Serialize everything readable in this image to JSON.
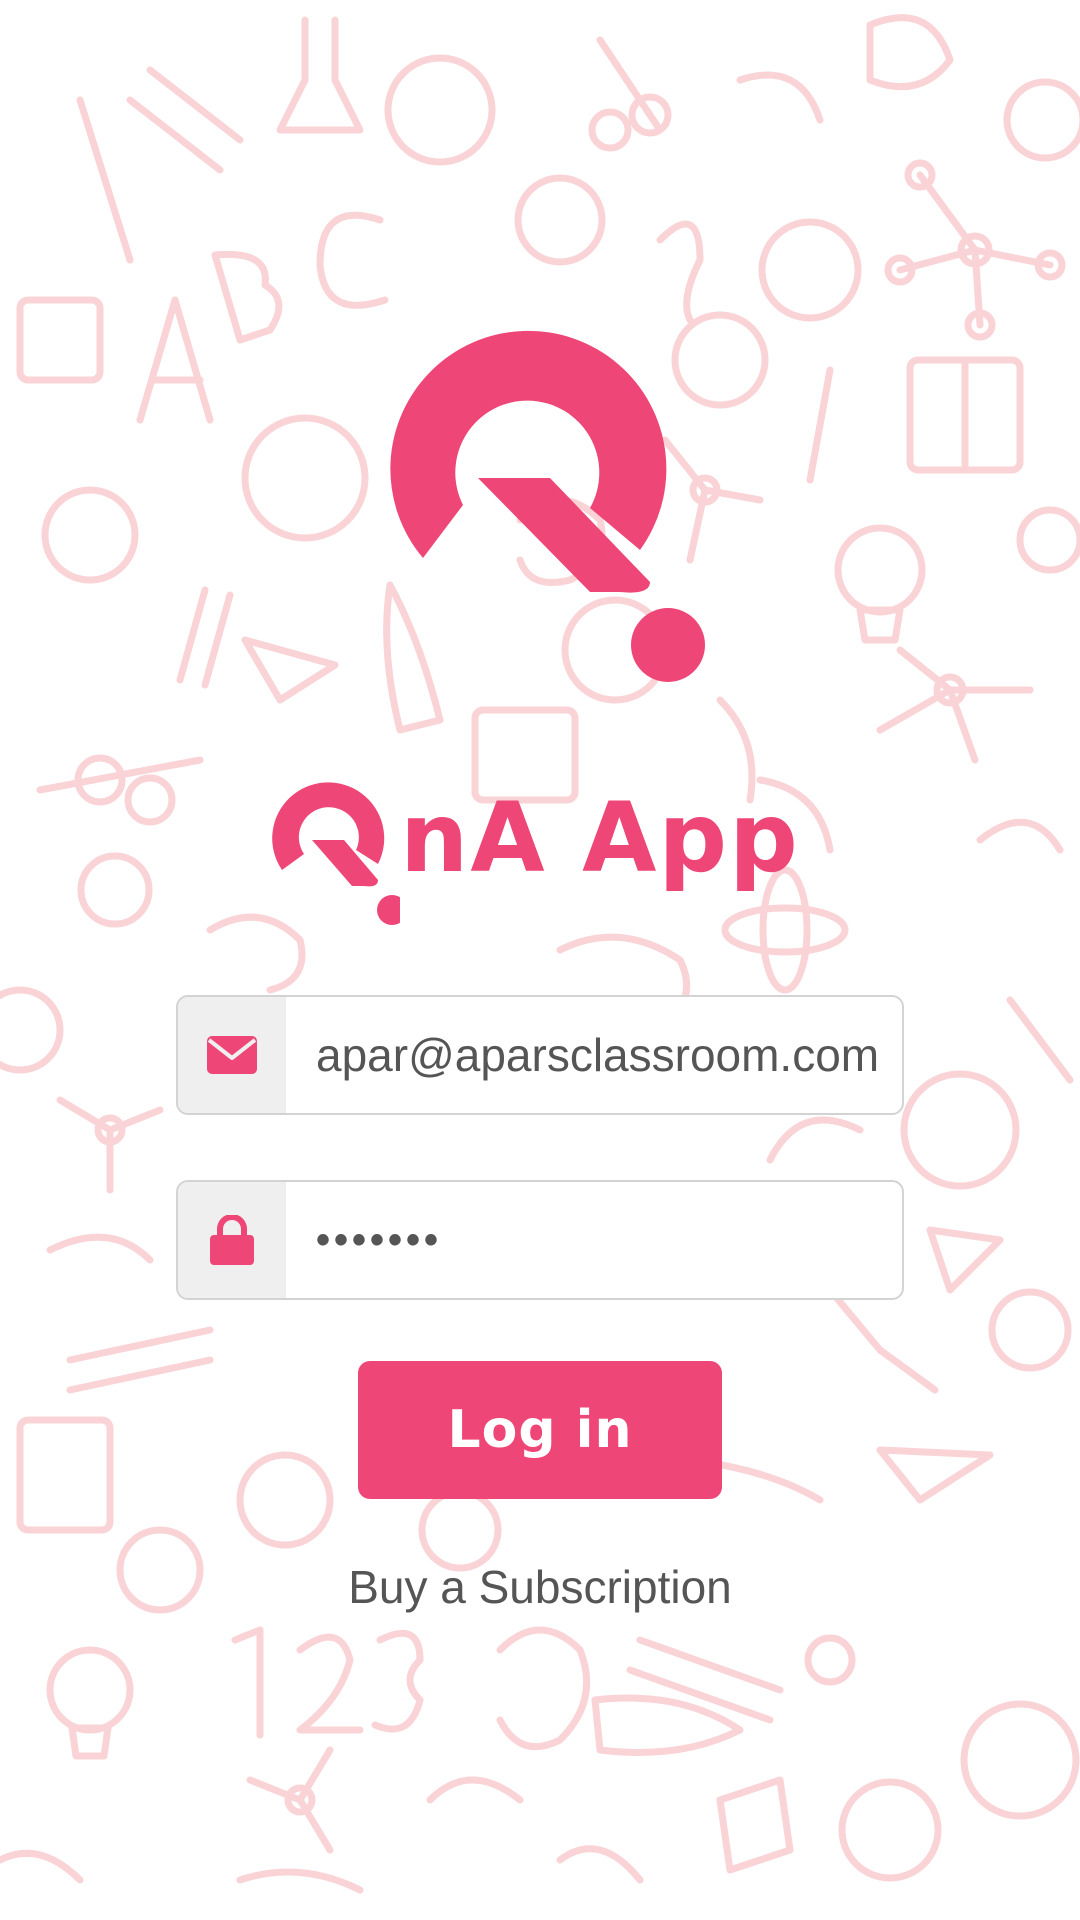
{
  "app": {
    "name": "QnA App",
    "brand_color": "#ee4677",
    "pattern_color": "#f9d3d6"
  },
  "logo": {
    "icon": "q-logo-icon",
    "wordmark_text": "nA App"
  },
  "form": {
    "email": {
      "icon": "envelope-icon",
      "value": "apar@aparsclassroom.com"
    },
    "password": {
      "icon": "lock-icon",
      "value": "•••••••"
    },
    "login_label": "Log in",
    "subscribe_label": "Buy a Subscription"
  }
}
